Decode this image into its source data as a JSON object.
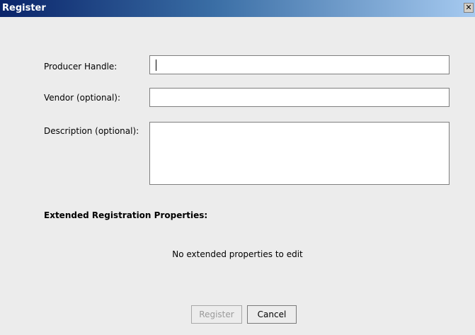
{
  "window": {
    "title": "Register",
    "close_glyph": "✕"
  },
  "form": {
    "producer_handle": {
      "label": "Producer Handle:",
      "value": ""
    },
    "vendor": {
      "label": "Vendor (optional):",
      "value": ""
    },
    "description": {
      "label": "Description (optional):",
      "value": ""
    }
  },
  "extended": {
    "title": "Extended Registration Properties:",
    "empty_message": "No extended properties to edit"
  },
  "buttons": {
    "register_label": "Register",
    "register_enabled": false,
    "cancel_label": "Cancel"
  }
}
